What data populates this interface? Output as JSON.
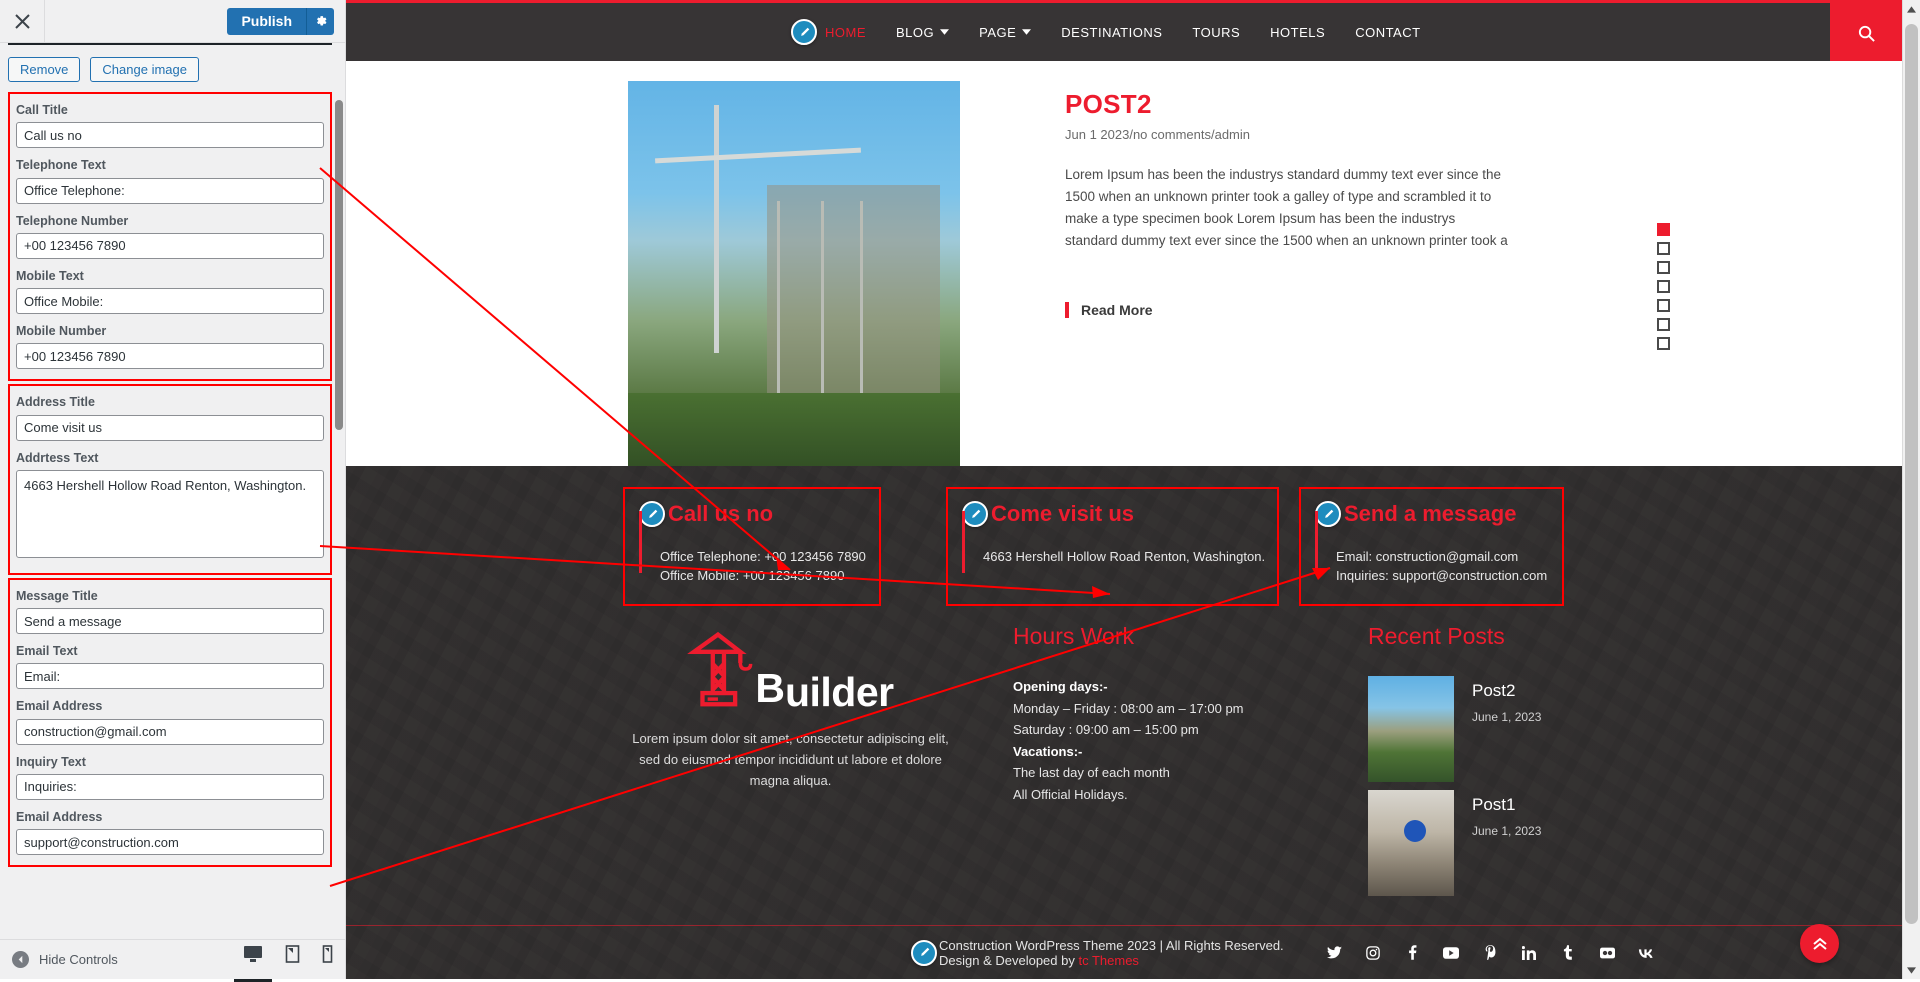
{
  "customizer": {
    "close_label": "Close customizer",
    "publish_label": "Publish",
    "gear_label": "Publish settings",
    "image_buttons": {
      "remove": "Remove",
      "change": "Change image"
    },
    "groups": [
      {
        "name": "call-info",
        "fields": [
          {
            "label": "Call Title",
            "value": "Call us no",
            "type": "text"
          },
          {
            "label": "Telephone Text",
            "value": "Office Telephone:",
            "type": "text"
          },
          {
            "label": "Telephone Number",
            "value": "+00 123456 7890",
            "type": "text"
          },
          {
            "label": "Mobile Text",
            "value": "Office Mobile:",
            "type": "text"
          },
          {
            "label": "Mobile Number",
            "value": "+00 123456 7890",
            "type": "text"
          }
        ]
      },
      {
        "name": "address-info",
        "fields": [
          {
            "label": "Address Title",
            "value": "Come visit us",
            "type": "text"
          },
          {
            "label": "Addrtess Text",
            "value": "4663 Hershell Hollow Road Renton, Washington.",
            "type": "textarea"
          }
        ]
      },
      {
        "name": "message-info",
        "fields": [
          {
            "label": "Message Title",
            "value": "Send a message",
            "type": "text"
          },
          {
            "label": "Email Text",
            "value": "Email:",
            "type": "text"
          },
          {
            "label": "Email Address",
            "value": "construction@gmail.com",
            "type": "text"
          },
          {
            "label": "Inquiry Text",
            "value": "Inquiries:",
            "type": "text"
          },
          {
            "label": "Email Address",
            "value": "support@construction.com",
            "type": "text"
          }
        ]
      }
    ],
    "footer": {
      "hide_controls": "Hide Controls",
      "devices": [
        {
          "name": "desktop",
          "label": "Enter desktop preview mode",
          "active": true
        },
        {
          "name": "tablet",
          "label": "Enter tablet preview mode",
          "active": false
        },
        {
          "name": "mobile",
          "label": "Enter mobile preview mode",
          "active": false
        }
      ]
    }
  },
  "preview": {
    "nav": [
      {
        "label": "HOME",
        "active": true,
        "caret": false
      },
      {
        "label": "BLOG",
        "active": false,
        "caret": true
      },
      {
        "label": "PAGE",
        "active": false,
        "caret": true
      },
      {
        "label": "DESTINATIONS",
        "active": false,
        "caret": false
      },
      {
        "label": "TOURS",
        "active": false,
        "caret": false
      },
      {
        "label": "HOTELS",
        "active": false,
        "caret": false
      },
      {
        "label": "CONTACT",
        "active": false,
        "caret": false
      }
    ],
    "search_label": "Search",
    "post": {
      "title": "POST2",
      "meta": "Jun 1 2023/no comments/admin",
      "text": "Lorem Ipsum has been the industrys standard dummy text ever since the 1500 when an unknown printer took a galley of type and scrambled it to make a type specimen book Lorem Ipsum has been the industrys standard dummy text ever since the 1500 when an unknown printer took a",
      "read_more": "Read More",
      "slider_dots": 7,
      "slider_active_index": 0
    },
    "contact_cards": [
      {
        "name": "call-card",
        "title": "Call us no",
        "lines": [
          "Office Telephone: +00 123456 7890",
          "Office Mobile: +00 123456 7890"
        ]
      },
      {
        "name": "address-card",
        "title": "Come visit us",
        "lines": [
          "4663 Hershell Hollow Road Renton, Washington."
        ]
      },
      {
        "name": "message-card",
        "title": "Send a message",
        "lines": [
          "Email: construction@gmail.com",
          "Inquiries: support@construction.com"
        ]
      }
    ],
    "brand": {
      "letter": "B",
      "word": "uilder",
      "description": "Lorem ipsum dolor sit amet, consectetur adipiscing elit, sed do eiusmod tempor incididunt ut labore et dolore magna aliqua."
    },
    "hours": {
      "title": "Hours Work",
      "opening_label": "Opening days:-",
      "weekday": "Monday – Friday : 08:00 am – 17:00 pm",
      "saturday": "Saturday : 09:00 am – 15:00 pm",
      "vacations_label": "Vacations:-",
      "vacation1": "The last day of each month",
      "vacation2": "All Official Holidays."
    },
    "recent_posts": {
      "title": "Recent Posts",
      "items": [
        {
          "title": "Post2",
          "date": "June 1, 2023"
        },
        {
          "title": "Post1",
          "date": "June 1, 2023"
        }
      ]
    },
    "footer_bottom": {
      "copyright": "Construction WordPress Theme 2023 | All Rights Reserved. Design & Developed by ",
      "credit_link": "tc Themes",
      "socials": [
        "twitter-icon",
        "instagram-icon",
        "facebook-icon",
        "youtube-icon",
        "pinterest-icon",
        "linkedin-icon",
        "tumblr-icon",
        "flickr-icon",
        "vk-icon"
      ],
      "back_to_top_label": "Back to top"
    }
  },
  "colors": {
    "accent_red": "#ed1c2e",
    "header_dark": "#373435",
    "annotation_red": "#ff0000",
    "wp_blue": "#2271b1",
    "pin_blue": "#1e8cbe"
  }
}
